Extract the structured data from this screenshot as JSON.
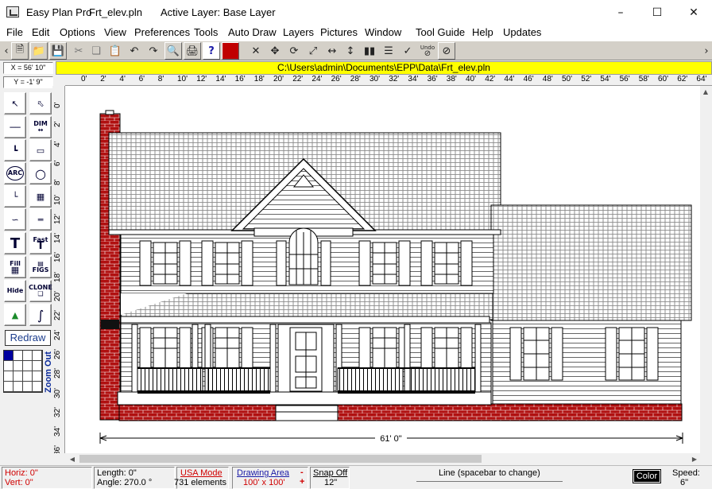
{
  "title": {
    "app_name": "Easy Plan Pro",
    "file_name": "Frt_elev.pln",
    "active_layer": "Active Layer: Base Layer"
  },
  "menu": [
    "File",
    "Edit",
    "Options",
    "View",
    "Preferences",
    "Tools",
    "Auto Draw",
    "Layers",
    "Pictures",
    "Window",
    "Tool Guide",
    "Help",
    "Updates"
  ],
  "toolbar": {
    "undo_label": "Undo"
  },
  "coords": {
    "x": "X = 56' 10\"",
    "y": "Y = -1' 9\""
  },
  "path": "C:\\Users\\admin\\Documents\\EPP\\Data\\Frt_elev.pln",
  "ruler": {
    "horizontal": [
      "0'",
      "2'",
      "4'",
      "6'",
      "8'",
      "10'",
      "12'",
      "14'",
      "16'",
      "18'",
      "20'",
      "22'",
      "24'",
      "26'",
      "28'",
      "30'",
      "32'",
      "34'",
      "36'",
      "38'",
      "40'",
      "42'",
      "44'",
      "46'",
      "48'",
      "50'",
      "52'",
      "54'",
      "56'",
      "58'",
      "60'",
      "62'",
      "64'"
    ],
    "vertical": [
      "0'",
      "2'",
      "4'",
      "6'",
      "8'",
      "10'",
      "12'",
      "14'",
      "16'",
      "18'",
      "20'",
      "22'",
      "24'",
      "26'",
      "28'",
      "30'",
      "32'",
      "34'",
      "36'"
    ]
  },
  "palette": {
    "dim": "DIM",
    "fast": "Fast",
    "fill": "Fill",
    "figs": "FIGS",
    "hide": "Hide",
    "clone": "CLONE",
    "arc": "ARC",
    "redraw": "Redraw",
    "zoom_out": "Zoom Out"
  },
  "drawing": {
    "dimension_label": "61' 0\""
  },
  "status": {
    "horiz": "Horiz: 0\"",
    "vert": "Vert: 0\"",
    "length": "Length: 0\"",
    "angle": "Angle: 270.0 °",
    "mode": "USA Mode",
    "elements": "731 elements",
    "drawing_area": "Drawing Area",
    "area_size": "100' x 100'",
    "snap": "Snap Off",
    "snap_size": "12\"",
    "hint": "Line  (spacebar to change)",
    "color": "Color",
    "speed_label": "Speed:",
    "speed_value": "6\""
  }
}
